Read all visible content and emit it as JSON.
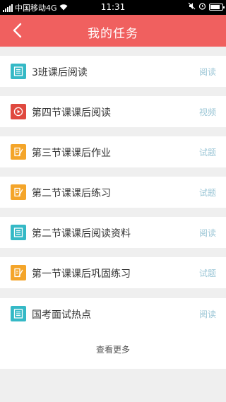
{
  "status_bar": {
    "carrier": "中国移动4G",
    "time": "11:31",
    "battery_level": 0.8
  },
  "header": {
    "title": "我的任务"
  },
  "tasks": [
    {
      "title": "3班课后阅读",
      "type": "阅读",
      "icon": "reading-icon",
      "color": "#35b9c6"
    },
    {
      "title": "第四节课课后阅读",
      "type": "视频",
      "icon": "video-icon",
      "color": "#e0493f"
    },
    {
      "title": "第三节课课后作业",
      "type": "试题",
      "icon": "quiz-icon",
      "color": "#f4a52a"
    },
    {
      "title": "第二节课课后练习",
      "type": "试题",
      "icon": "quiz-icon",
      "color": "#f4a52a"
    },
    {
      "title": "第二节课课后阅读资料",
      "type": "阅读",
      "icon": "reading-icon",
      "color": "#35b9c6"
    },
    {
      "title": "第一节课课后巩固练习",
      "type": "试题",
      "icon": "quiz-icon",
      "color": "#f4a52a"
    },
    {
      "title": "国考面试热点",
      "type": "阅读",
      "icon": "reading-icon",
      "color": "#35b9c6"
    }
  ],
  "more_label": "查看更多",
  "colors": {
    "header": "#f0605f",
    "type_label": "#9bc6d6"
  }
}
